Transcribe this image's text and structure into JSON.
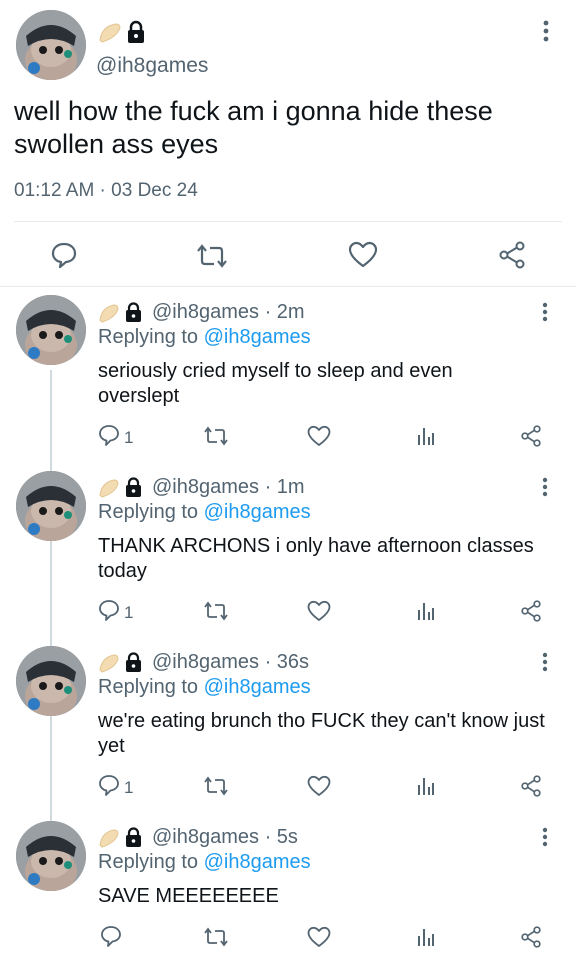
{
  "main_tweet": {
    "handle": "@ih8games",
    "text": "well how the fuck am i gonna hide these swollen ass eyes",
    "timestamp": "01:12 AM · 03 Dec 24",
    "badges": [
      "dumpling-emoji",
      "lock-icon"
    ]
  },
  "replies": [
    {
      "handle_time": "@ih8games · 2m",
      "replying_prefix": "Replying to ",
      "replying_to": "@ih8games",
      "text": "seriously cried myself to sleep and even overslept",
      "reply_count": "1"
    },
    {
      "handle_time": "@ih8games · 1m",
      "replying_prefix": "Replying to ",
      "replying_to": "@ih8games",
      "text": "THANK ARCHONS i only have afternoon classes today",
      "reply_count": "1"
    },
    {
      "handle_time": "@ih8games · 36s",
      "replying_prefix": "Replying to ",
      "replying_to": "@ih8games",
      "text": "we're eating brunch tho FUCK they can't know just yet",
      "reply_count": "1"
    },
    {
      "handle_time": "@ih8games · 5s",
      "replying_prefix": "Replying to ",
      "replying_to": "@ih8games",
      "text": "SAVE MEEEEEEEE",
      "reply_count": ""
    }
  ],
  "colors": {
    "text": "#0f1419",
    "muted": "#536471",
    "mention": "#1d9bf0",
    "divider": "#e6ecf0"
  }
}
